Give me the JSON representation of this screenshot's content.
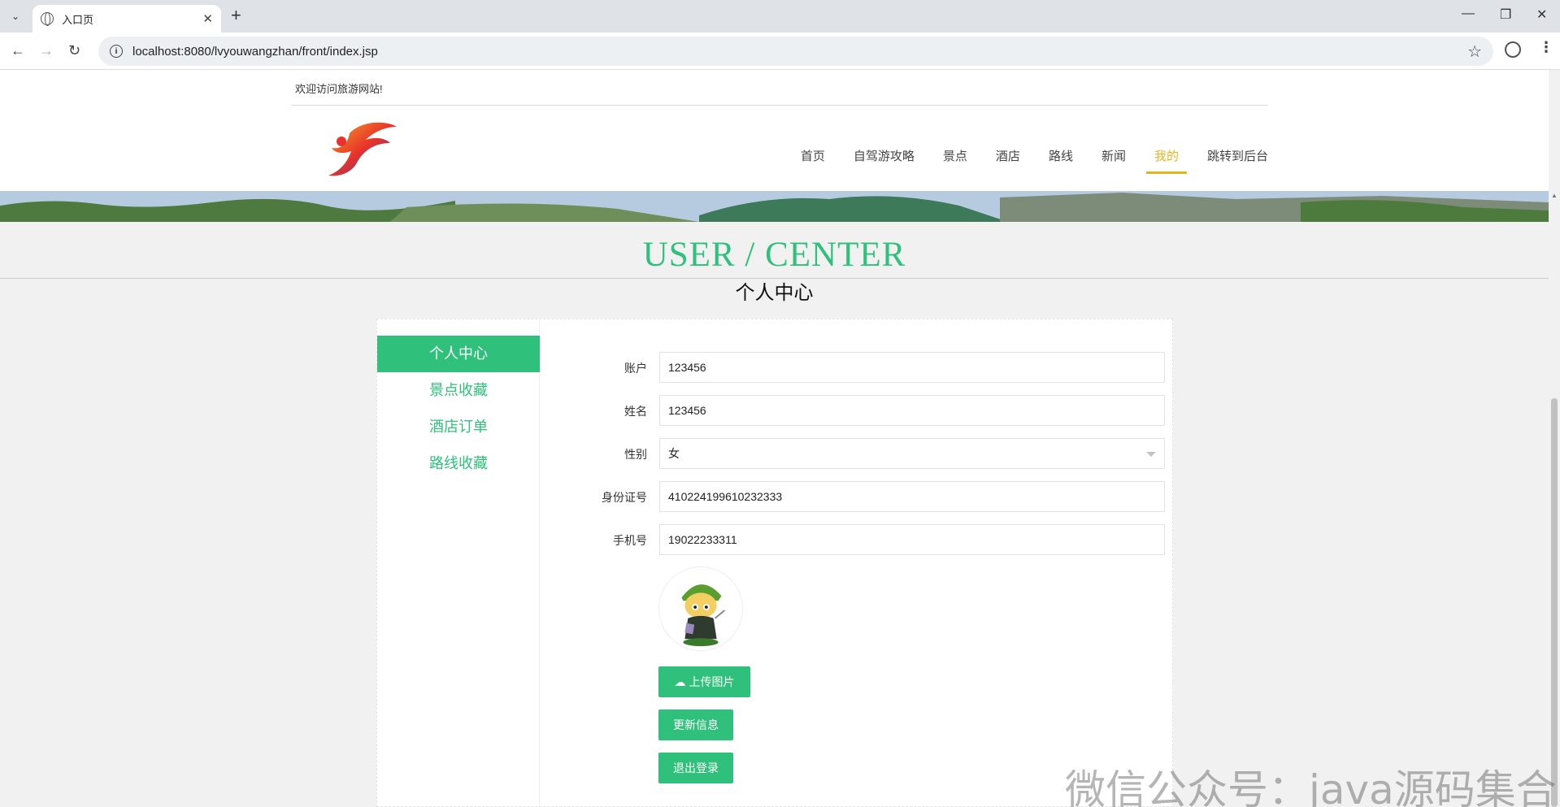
{
  "browser": {
    "tab_title": "入口页",
    "url": "localhost:8080/lvyouwangzhan/front/index.jsp"
  },
  "header": {
    "welcome": "欢迎访问旅游网站!",
    "nav": [
      "首页",
      "自驾游攻略",
      "景点",
      "酒店",
      "路线",
      "新闻",
      "我的",
      "跳转到后台"
    ],
    "active_nav": "我的"
  },
  "title": {
    "en": "USER / CENTER",
    "zh": "个人中心"
  },
  "sidebar": {
    "items": [
      {
        "label": "个人中心",
        "active": true
      },
      {
        "label": "景点收藏",
        "active": false
      },
      {
        "label": "酒店订单",
        "active": false
      },
      {
        "label": "路线收藏",
        "active": false
      }
    ]
  },
  "form": {
    "account": {
      "label": "账户",
      "value": "123456"
    },
    "name": {
      "label": "姓名",
      "value": "123456"
    },
    "gender": {
      "label": "性别",
      "value": "女"
    },
    "id_card": {
      "label": "身份证号",
      "value": "410224199610232333"
    },
    "phone": {
      "label": "手机号",
      "value": "19022233311"
    }
  },
  "buttons": {
    "upload": "上传图片",
    "update": "更新信息",
    "logout": "退出登录"
  },
  "watermark": "微信公众号：java源码集合",
  "colors": {
    "accent": "#2fc07c",
    "nav_active": "#e6b422"
  }
}
